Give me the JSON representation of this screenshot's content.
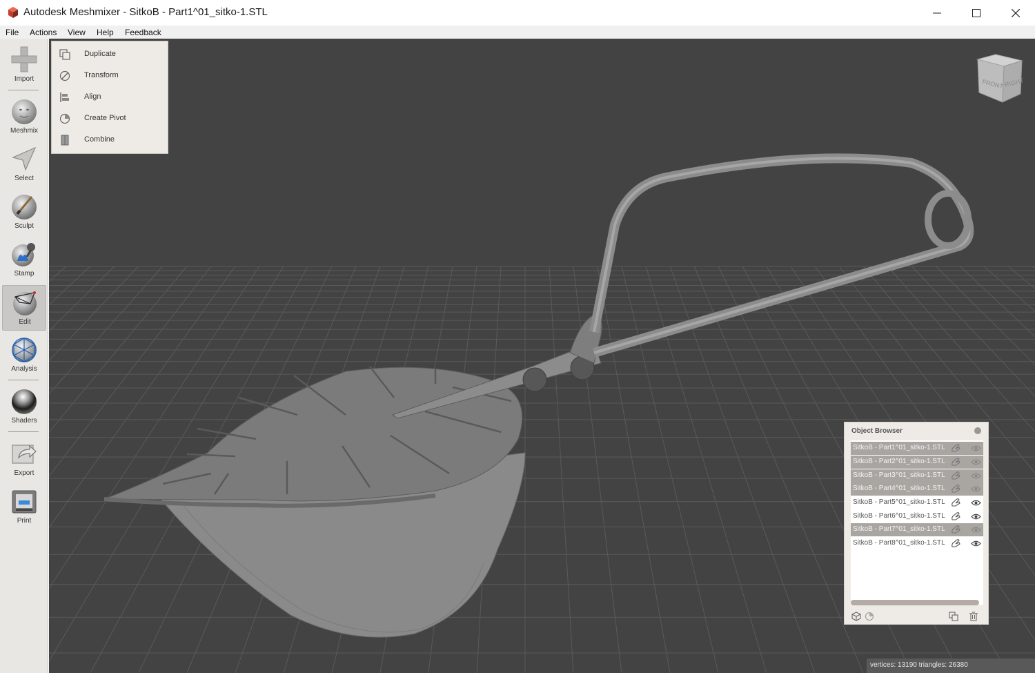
{
  "window": {
    "title": "Autodesk Meshmixer - SitkoB - Part1^01_sitko-1.STL",
    "controls": [
      "minimize",
      "maximize",
      "close"
    ]
  },
  "menu": [
    "File",
    "Actions",
    "View",
    "Help",
    "Feedback"
  ],
  "tools": [
    {
      "label": "Import",
      "icon": "import-plus-icon",
      "active": false
    },
    {
      "label": "Meshmix",
      "icon": "meshmix-head-icon",
      "active": false
    },
    {
      "label": "Select",
      "icon": "select-arrow-icon",
      "active": false
    },
    {
      "label": "Sculpt",
      "icon": "sculpt-brush-icon",
      "active": false
    },
    {
      "label": "Stamp",
      "icon": "stamp-icon",
      "active": false
    },
    {
      "label": "Edit",
      "icon": "edit-sphere-icon",
      "active": true
    },
    {
      "label": "Analysis",
      "icon": "analysis-mesh-icon",
      "active": false
    },
    {
      "label": "Shaders",
      "icon": "shaders-ball-icon",
      "active": false
    },
    {
      "label": "Export",
      "icon": "export-icon",
      "active": false
    },
    {
      "label": "Print",
      "icon": "print-icon",
      "active": false
    }
  ],
  "edit_menu": [
    {
      "label": "Duplicate",
      "icon": "duplicate-icon"
    },
    {
      "label": "Transform",
      "icon": "transform-icon"
    },
    {
      "label": "Align",
      "icon": "align-icon"
    },
    {
      "label": "Create Pivot",
      "icon": "create-pivot-icon"
    },
    {
      "label": "Combine",
      "icon": "combine-icon"
    }
  ],
  "navcube": {
    "front": "FRONT",
    "right": "RIGHT"
  },
  "object_browser": {
    "title": "Object Browser",
    "objects": [
      {
        "name": "SitkoB - Part1^01_sitko-1.STL",
        "selected": true
      },
      {
        "name": "SitkoB - Part2^01_sitko-1.STL",
        "selected": true
      },
      {
        "name": "SitkoB - Part3^01_sitko-1.STL",
        "selected": true
      },
      {
        "name": "SitkoB - Part4^01_sitko-1.STL",
        "selected": true
      },
      {
        "name": "SitkoB - Part5^01_sitko-1.STL",
        "selected": false
      },
      {
        "name": "SitkoB - Part6^01_sitko-1.STL",
        "selected": false
      },
      {
        "name": "SitkoB - Part7^01_sitko-1.STL",
        "selected": true
      },
      {
        "name": "SitkoB - Part8^01_sitko-1.STL",
        "selected": false
      }
    ],
    "footer_icons": [
      "cube-icon",
      "pivot-icon",
      "duplicate-icon",
      "trash-icon"
    ]
  },
  "status": {
    "text": "vertices: 13190 triangles: 26380"
  },
  "colors": {
    "viewport": "#434343",
    "grid": "#5a5a5a",
    "mesh": "#8e8e8e",
    "selection": "#a9a6a2"
  }
}
